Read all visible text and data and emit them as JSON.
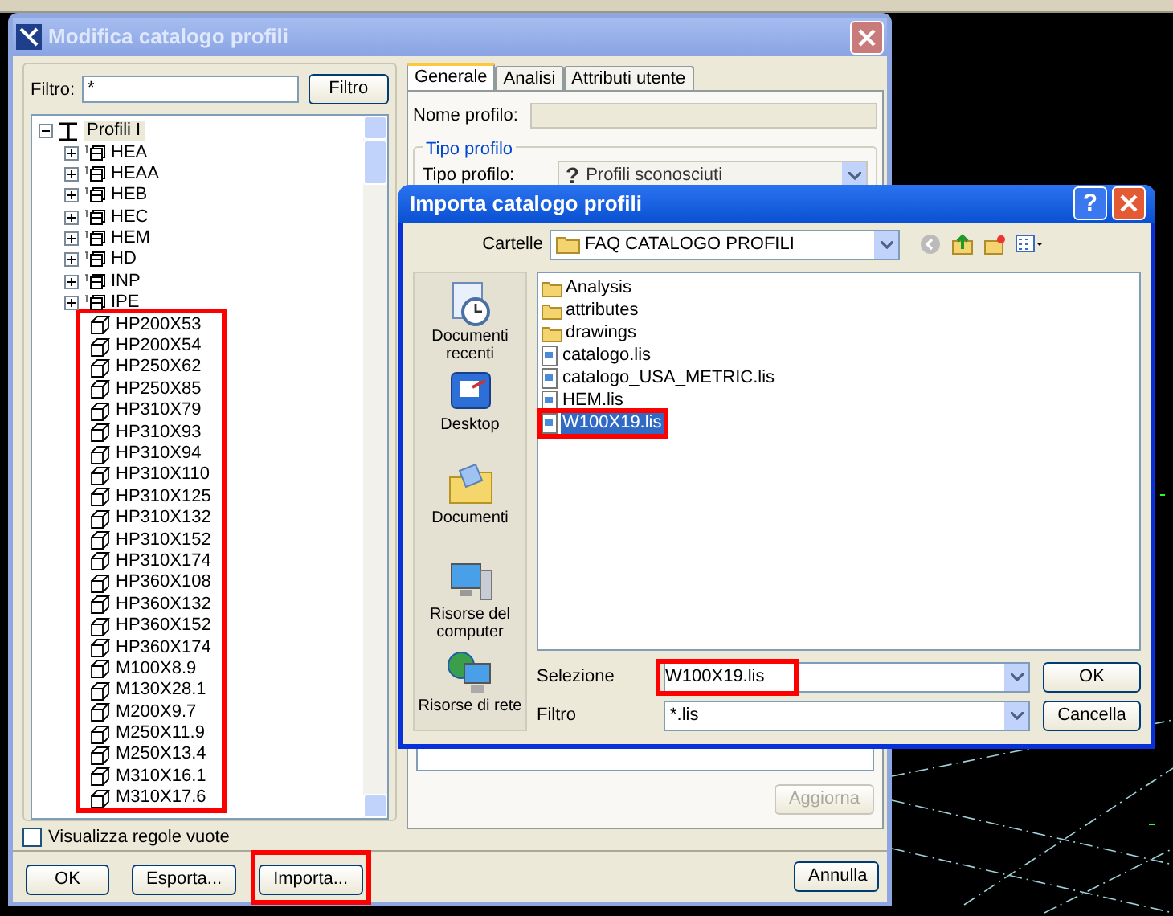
{
  "main_dialog": {
    "title": "Modifica catalogo profili",
    "filter": {
      "label": "Filtro:",
      "value": "*",
      "button": "Filtro"
    },
    "tree": {
      "profiles_highlighted": true,
      "items": [
        {
          "label": "Profili I",
          "kind": "group",
          "expanded": true,
          "selected": true,
          "children": [
            {
              "label": "HEA",
              "kind": "family",
              "expanded": false
            },
            {
              "label": "HEAA",
              "kind": "family",
              "expanded": false
            },
            {
              "label": "HEB",
              "kind": "family",
              "expanded": false
            },
            {
              "label": "HEC",
              "kind": "family",
              "expanded": false
            },
            {
              "label": "HEM",
              "kind": "family",
              "expanded": false
            },
            {
              "label": "HD",
              "kind": "family",
              "expanded": false
            },
            {
              "label": "INP",
              "kind": "family",
              "expanded": false
            },
            {
              "label": "IPE",
              "kind": "family",
              "expanded": false
            },
            {
              "label": "HP200X53",
              "kind": "profile"
            },
            {
              "label": "HP200X54",
              "kind": "profile"
            },
            {
              "label": "HP250X62",
              "kind": "profile"
            },
            {
              "label": "HP250X85",
              "kind": "profile"
            },
            {
              "label": "HP310X79",
              "kind": "profile"
            },
            {
              "label": "HP310X93",
              "kind": "profile"
            },
            {
              "label": "HP310X94",
              "kind": "profile"
            },
            {
              "label": "HP310X110",
              "kind": "profile"
            },
            {
              "label": "HP310X125",
              "kind": "profile"
            },
            {
              "label": "HP310X132",
              "kind": "profile"
            },
            {
              "label": "HP310X152",
              "kind": "profile"
            },
            {
              "label": "HP310X174",
              "kind": "profile"
            },
            {
              "label": "HP360X108",
              "kind": "profile"
            },
            {
              "label": "HP360X132",
              "kind": "profile"
            },
            {
              "label": "HP360X152",
              "kind": "profile"
            },
            {
              "label": "HP360X174",
              "kind": "profile"
            },
            {
              "label": "M100X8.9",
              "kind": "profile"
            },
            {
              "label": "M130X28.1",
              "kind": "profile"
            },
            {
              "label": "M200X9.7",
              "kind": "profile"
            },
            {
              "label": "M250X11.9",
              "kind": "profile"
            },
            {
              "label": "M250X13.4",
              "kind": "profile"
            },
            {
              "label": "M310X16.1",
              "kind": "profile"
            },
            {
              "label": "M310X17.6",
              "kind": "profile"
            }
          ]
        }
      ]
    },
    "show_empty_rules": {
      "label": "Visualizza regole vuote",
      "checked": false
    },
    "buttons": [
      {
        "label": "OK",
        "highlighted": false
      },
      {
        "label": "Esporta...",
        "highlighted": false
      },
      {
        "label": "Importa...",
        "highlighted": true
      }
    ],
    "cancel_button": "Annulla",
    "tabs": [
      {
        "label": "Generale",
        "selected": true
      },
      {
        "label": "Analisi",
        "selected": false
      },
      {
        "label": "Attributi utente",
        "selected": false
      }
    ],
    "profile_name": {
      "label": "Nome profilo:",
      "disabled": true
    },
    "profile_type": {
      "group_title": "Tipo profilo",
      "label": "Tipo profilo:",
      "icon": "?",
      "value": "Profili sconosciuti",
      "disabled": true
    },
    "update_button": {
      "label": "Aggiorna",
      "disabled": true
    }
  },
  "import_dialog": {
    "title": "Importa catalogo profili",
    "help": "?",
    "folder_label": "Cartelle",
    "folder": "FAQ CATALOGO PROFILI",
    "places": [
      {
        "label": "Documenti recenti",
        "kind": "recent"
      },
      {
        "label": "Desktop",
        "kind": "desktop"
      },
      {
        "label": "Documenti",
        "kind": "documents"
      },
      {
        "label": "Risorse del computer",
        "kind": "computer"
      },
      {
        "label": "Risorse di rete",
        "kind": "network"
      }
    ],
    "files": [
      {
        "name": "Analysis",
        "kind": "folder",
        "selected": false,
        "highlighted": false
      },
      {
        "name": "attributes",
        "kind": "folder",
        "selected": false,
        "highlighted": false
      },
      {
        "name": "drawings",
        "kind": "folder",
        "selected": false,
        "highlighted": false
      },
      {
        "name": "catalogo.lis",
        "kind": "file",
        "selected": false,
        "highlighted": false
      },
      {
        "name": "catalogo_USA_METRIC.lis",
        "kind": "file",
        "selected": false,
        "highlighted": false
      },
      {
        "name": "HEM.lis",
        "kind": "file",
        "selected": false,
        "highlighted": false
      },
      {
        "name": "W100X19.lis",
        "kind": "file",
        "selected": true,
        "highlighted": true
      }
    ],
    "selection": {
      "label": "Selezione",
      "value": "W100X19.lis",
      "highlighted": true
    },
    "filter": {
      "label": "Filtro",
      "value": "*.lis"
    },
    "ok": "OK",
    "cancel": "Cancella"
  }
}
